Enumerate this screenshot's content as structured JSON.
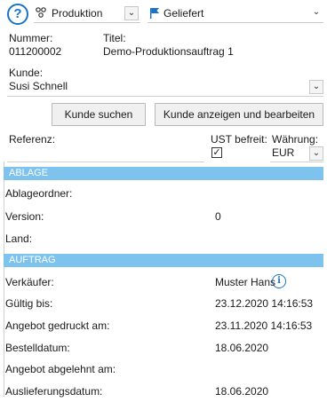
{
  "header": {
    "category_icon": "structure-icon",
    "category_value": "Produktion",
    "status_icon": "flag-icon",
    "status_color": "#1a73c8",
    "status_value": "Geliefert"
  },
  "order": {
    "number_label": "Nummer:",
    "number_value": "011200002",
    "title_label": "Titel:",
    "title_value": "Demo-Produktionsauftrag 1",
    "customer_label": "Kunde:",
    "customer_value": "Susi Schnell"
  },
  "buttons": {
    "search_customer": "Kunde suchen",
    "show_edit_customer": "Kunde anzeigen und bearbeiten"
  },
  "reference": {
    "label": "Referenz:",
    "value": "",
    "vat_free_label": "UST befreit:",
    "vat_free_checked": true,
    "currency_label": "Währung:",
    "currency_value": "EUR"
  },
  "ablage": {
    "title": "ABLAGE",
    "folder_label": "Ablageordner:",
    "folder_value": "",
    "version_label": "Version:",
    "version_value": "0",
    "country_label": "Land:",
    "country_value": ""
  },
  "auftrag": {
    "title": "AUFTRAG",
    "seller_label": "Verkäufer:",
    "seller_value": "Muster Hans",
    "valid_label": "Gültig bis:",
    "valid_value": "23.12.2020 14:16:53",
    "printed_label": "Angebot gedruckt am:",
    "printed_value": "23.11.2020 14:16:53",
    "order_date_label": "Bestelldatum:",
    "order_date_value": "18.06.2020",
    "rejected_label": "Angebot abgelehnt am:",
    "rejected_value": "",
    "delivery_label": "Auslieferungsdatum:",
    "delivery_value": "18.06.2020"
  },
  "colors": {
    "section_bg": "#7ec3ee",
    "accent": "#1a73c8"
  }
}
